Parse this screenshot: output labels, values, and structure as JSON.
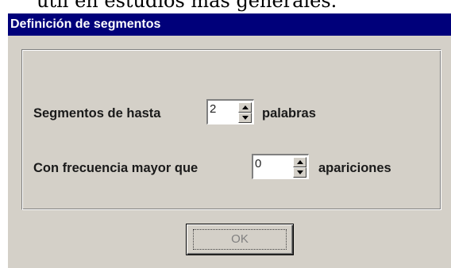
{
  "background_text": "útil en estudios más generales.",
  "dialog": {
    "title": "Definición de segmentos",
    "colors": {
      "titlebar": "#00007a",
      "face": "#d4d0c8"
    },
    "segments_row": {
      "label_before": "Segmentos de hasta",
      "value": "2",
      "label_after": "palabras"
    },
    "frequency_row": {
      "label_before": "Con frecuencia mayor que",
      "value": "0",
      "label_after": "apariciones"
    },
    "ok_label": "OK"
  }
}
